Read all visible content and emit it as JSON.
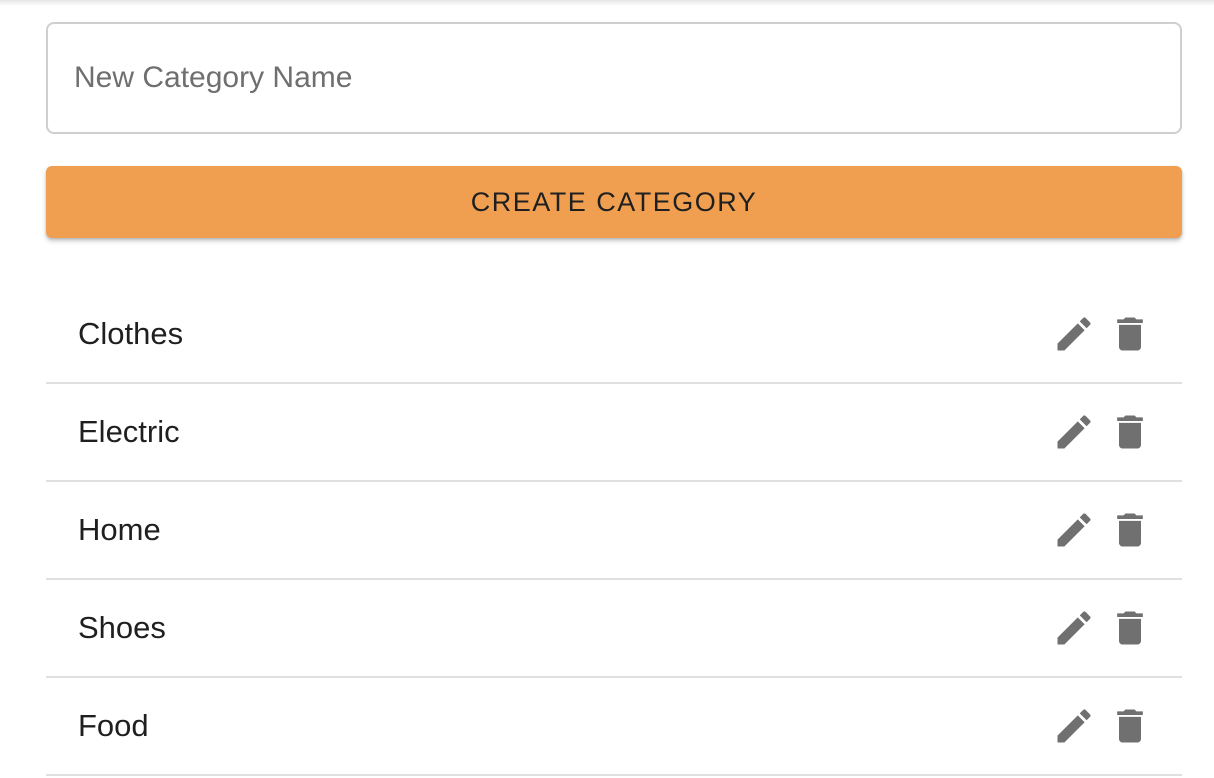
{
  "form": {
    "input_value": "",
    "input_placeholder": "New Category Name",
    "create_label": "CREATE CATEGORY",
    "accent_color": "#f09f50"
  },
  "categories": [
    {
      "label": "Clothes",
      "edit_icon": "pencil-icon",
      "delete_icon": "trash-icon"
    },
    {
      "label": "Electric",
      "edit_icon": "pencil-icon",
      "delete_icon": "trash-icon"
    },
    {
      "label": "Home",
      "edit_icon": "pencil-icon",
      "delete_icon": "trash-icon"
    },
    {
      "label": "Shoes",
      "edit_icon": "pencil-icon",
      "delete_icon": "trash-icon"
    },
    {
      "label": "Food",
      "edit_icon": "pencil-icon",
      "delete_icon": "trash-icon"
    }
  ]
}
